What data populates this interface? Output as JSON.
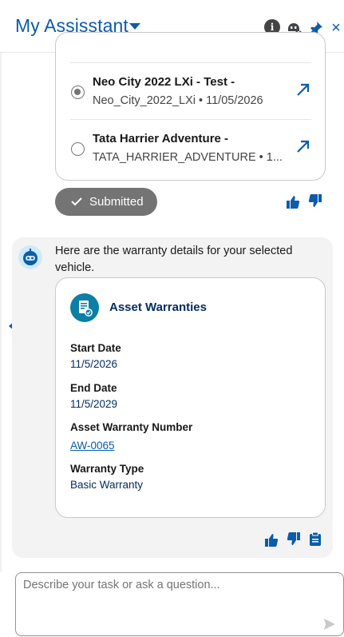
{
  "header": {
    "title": "My Assisstant",
    "icons": [
      "info-icon",
      "bot-off-icon",
      "pin-icon",
      "close-icon"
    ],
    "close_glyph": "×",
    "info_glyph": "i"
  },
  "records": [
    {
      "title": "Neo City 2022 LXi - Test -",
      "subtitle": "Neo_City_2022_LXi • 11/05/2026",
      "selected": true
    },
    {
      "title": "Tata Harrier Adventure -",
      "subtitle": "TATA_HARRIER_ADVENTURE • 1...",
      "selected": false
    }
  ],
  "submitted": {
    "label": "Submitted"
  },
  "response": {
    "text": "Here are the warranty details for your selected vehicle.",
    "card": {
      "title": "Asset Warranties",
      "fields": [
        {
          "label": "Start Date",
          "value": "11/5/2026"
        },
        {
          "label": "End Date",
          "value": "11/5/2029"
        },
        {
          "label": "Asset Warranty Number",
          "value": "AW-0065",
          "is_link": true
        },
        {
          "label": "Warranty Type",
          "value": "Basic Warranty"
        }
      ]
    }
  },
  "composer": {
    "placeholder": "Describe your task or ask a question..."
  },
  "colors": {
    "brand": "#0b5cab",
    "pill": "#747474",
    "bubble": "#f3f3f3",
    "asset_icon": "#0b7fa5"
  }
}
